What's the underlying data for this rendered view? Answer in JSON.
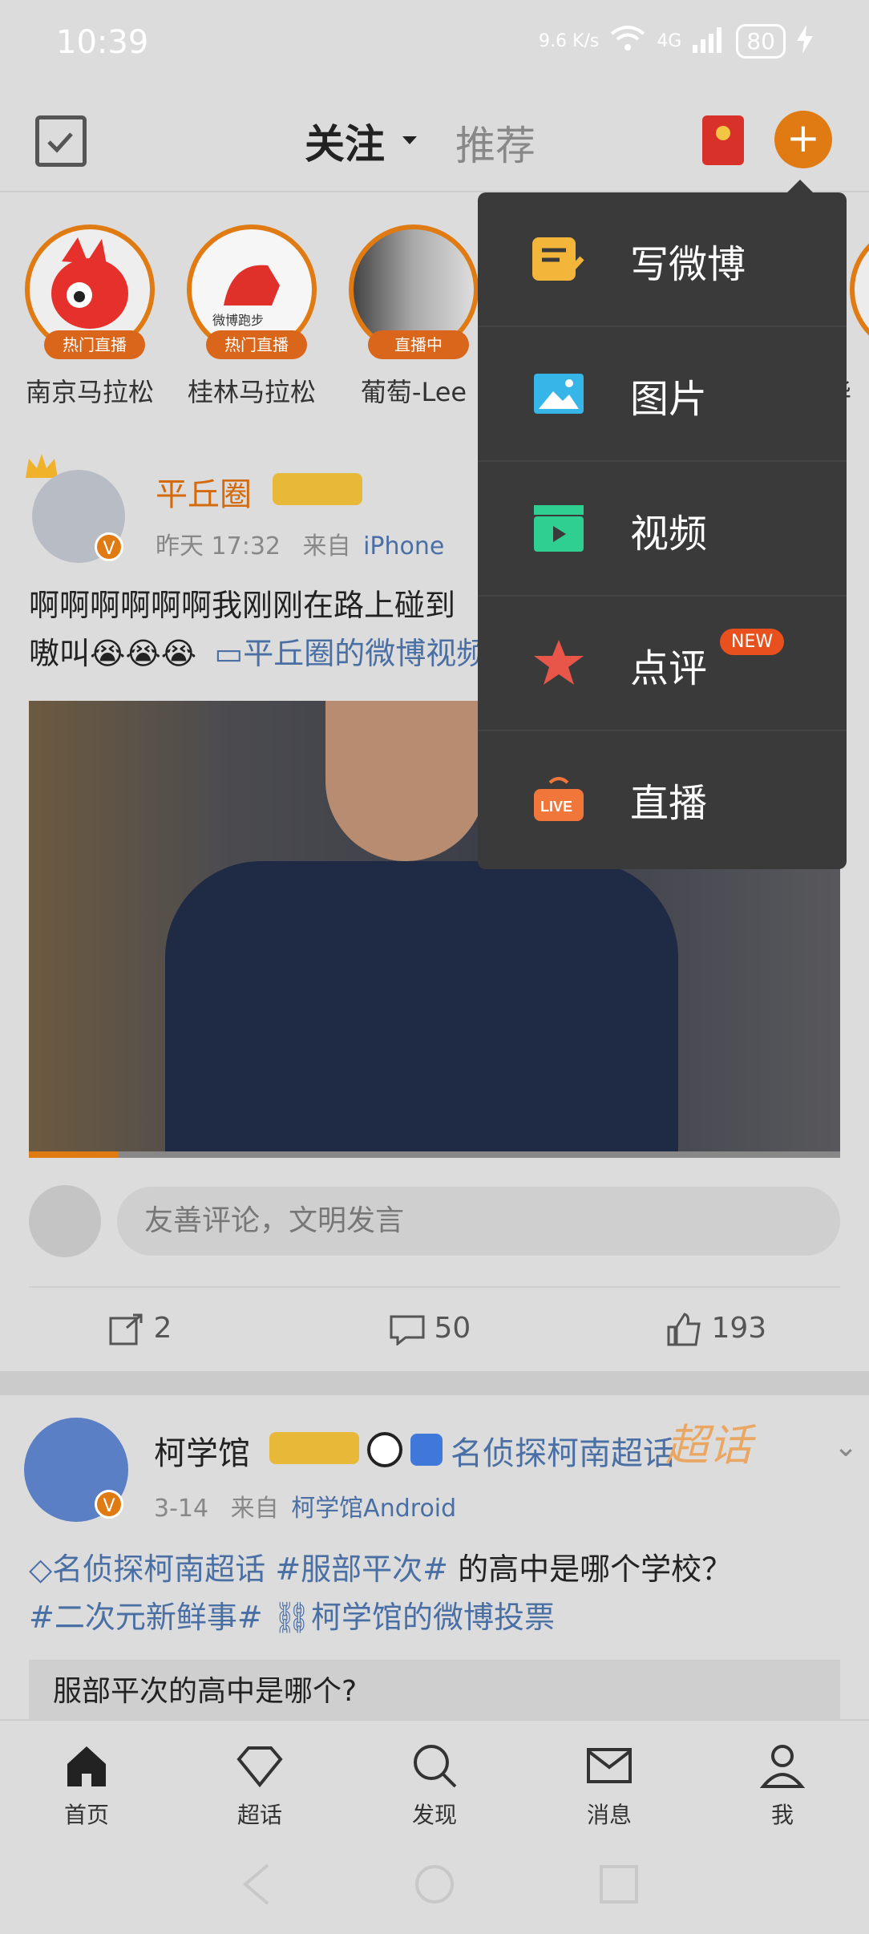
{
  "status": {
    "time": "10:39",
    "net_speed": "9.6 K/s",
    "signal": "4G",
    "battery": "80"
  },
  "topbar": {
    "follow": "关注",
    "recommend": "推荐"
  },
  "stories": [
    {
      "name": "南京马拉松",
      "badge": "热门直播"
    },
    {
      "name": "桂林马拉松",
      "badge": "热门直播",
      "logo_text": "微博跑步"
    },
    {
      "name": "葡萄-Lee",
      "badge": "直播中"
    },
    {
      "name": "华",
      "badge": ""
    }
  ],
  "post1": {
    "user": "平丘圈",
    "time": "昨天 17:32",
    "from_prefix": "来自",
    "source": "iPhone",
    "text": "啊啊啊啊啊啊我刚刚在路上碰到",
    "text2": "嗷叫😭😭😭",
    "video_link": "平丘圈的微博视频",
    "comment_placeholder": "友善评论，文明发言",
    "reposts": "2",
    "comments": "50",
    "likes": "193"
  },
  "post2": {
    "user": "柯学馆",
    "topic": "名侦探柯南超话",
    "chaohua_badge": "超话",
    "time": "3-14",
    "from_prefix": "来自",
    "source": "柯学馆Android",
    "text_link1": "名侦探柯南超话",
    "text_tag1": "#服部平次#",
    "text_mid": " 的高中是哪个学校？",
    "text_tag2": "#二次元新鲜事#",
    "text_link2": "柯学馆的微博投票",
    "poll": "服部平次的高中是哪个?"
  },
  "dropdown": [
    {
      "label": "写微博",
      "icon": "compose-icon",
      "color": "#f4b63a"
    },
    {
      "label": "图片",
      "icon": "image-icon",
      "color": "#35b5e8"
    },
    {
      "label": "视频",
      "icon": "video-icon",
      "color": "#2fcf92"
    },
    {
      "label": "点评",
      "icon": "review-icon",
      "color": "#e8564a",
      "badge": "NEW"
    },
    {
      "label": "直播",
      "icon": "live-icon",
      "color": "#f0763a",
      "icon_text": "LIVE"
    }
  ],
  "nav": [
    {
      "label": "首页",
      "icon": "home-icon"
    },
    {
      "label": "超话",
      "icon": "diamond-icon"
    },
    {
      "label": "发现",
      "icon": "search-icon"
    },
    {
      "label": "消息",
      "icon": "mail-icon"
    },
    {
      "label": "我",
      "icon": "profile-icon"
    }
  ]
}
